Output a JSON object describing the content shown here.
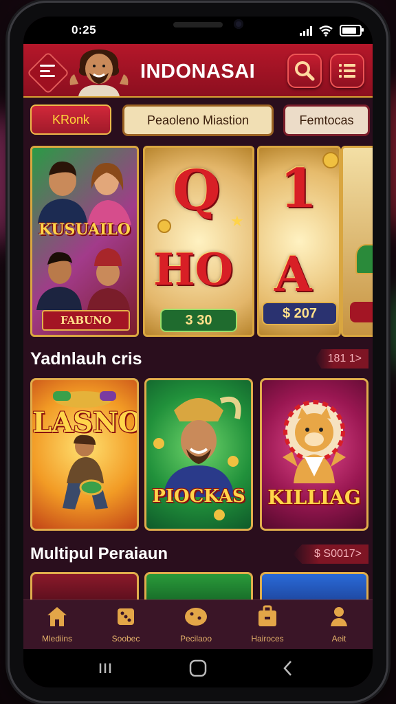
{
  "status": {
    "time": "0:25"
  },
  "header": {
    "title": "INDONASAI"
  },
  "tabs": [
    {
      "label": "KRonk",
      "state": "active"
    },
    {
      "label": "Peaoleno Miastion",
      "state": "normal"
    },
    {
      "label": "Femtocas",
      "state": "normal"
    }
  ],
  "slots": {
    "card1": {
      "title": "KUSUAILO",
      "banner": "FABUNO"
    },
    "card2": {
      "symbols": [
        "Q",
        "HO"
      ],
      "value": "3 30"
    },
    "card3": {
      "symbols": [
        "1",
        "A"
      ],
      "value": "$ 207"
    }
  },
  "section1": {
    "title": "Yadnlauh cris",
    "pill": "181 1>"
  },
  "tiles": [
    {
      "name": "LASNO"
    },
    {
      "name": "PIOCKAS"
    },
    {
      "name": "KILLIAG"
    }
  ],
  "section2": {
    "title": "Multipul Peraiaun",
    "pill": "$ S0017>"
  },
  "nav": [
    {
      "label": "Mlediins",
      "icon": "home-icon"
    },
    {
      "label": "Soobec",
      "icon": "dice-icon"
    },
    {
      "label": "Pecilaoo",
      "icon": "cookie-icon"
    },
    {
      "label": "Hairoces",
      "icon": "briefcase-icon"
    },
    {
      "label": "Aeit",
      "icon": "person-icon"
    }
  ],
  "colors": {
    "header": "#b5172a",
    "gold": "#d9a640",
    "background": "#2a0e1d"
  }
}
